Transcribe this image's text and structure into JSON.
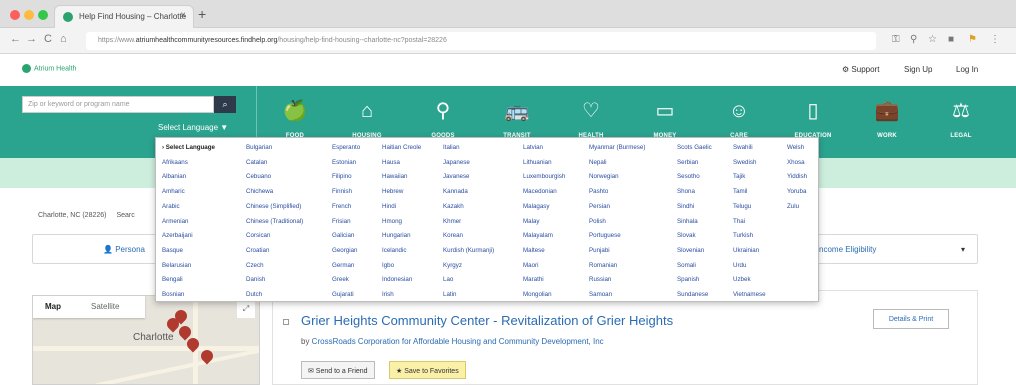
{
  "browser": {
    "tab_title": "Help Find Housing – Charlotte",
    "tab_close": "×",
    "new_tab": "+",
    "back_glyph": "←",
    "forward_glyph": "→",
    "reload_glyph": "C",
    "home_glyph": "⌂",
    "url_prefix": "https://www.",
    "url_bold": "atriumhealthcommunityresources.findhelp.org",
    "url_rest": "/housing/help-find-housing--charlotte-nc?postal=28226"
  },
  "site": {
    "logo_text": "Atrium Health",
    "support_label": "Support",
    "signup_label": "Sign Up",
    "login_label": "Log In"
  },
  "search": {
    "placeholder": "Zip or keyword or program name",
    "button_glyph": "🔍",
    "select_language_label": "Select Language ▼"
  },
  "categories": [
    {
      "label": "FOOD",
      "icon": "🍏"
    },
    {
      "label": "HOUSING",
      "icon": "⌂"
    },
    {
      "label": "GOODS",
      "icon": "⚲"
    },
    {
      "label": "TRANSIT",
      "icon": "🚌"
    },
    {
      "label": "HEALTH",
      "icon": "♡"
    },
    {
      "label": "MONEY",
      "icon": "▭"
    },
    {
      "label": "CARE",
      "icon": "☺"
    },
    {
      "label": "EDUCATION",
      "icon": "▯"
    },
    {
      "label": "WORK",
      "icon": "💼"
    },
    {
      "label": "LEGAL",
      "icon": "⚖"
    }
  ],
  "languages": {
    "selected": "› Select Language",
    "columns": [
      [
        "› Select Language",
        "Afrikaans",
        "Albanian",
        "Amharic",
        "Arabic",
        "Armenian",
        "Azerbaijani",
        "Basque",
        "Belarusian",
        "Bengali",
        "Bosnian"
      ],
      [
        "Bulgarian",
        "Catalan",
        "Cebuano",
        "Chichewa",
        "Chinese (Simplified)",
        "Chinese (Traditional)",
        "Corsican",
        "Croatian",
        "Czech",
        "Danish",
        "Dutch"
      ],
      [
        "Esperanto",
        "Estonian",
        "Filipino",
        "Finnish",
        "French",
        "Frisian",
        "Galician",
        "Georgian",
        "German",
        "Greek",
        "Gujarati"
      ],
      [
        "Haitian Creole",
        "Hausa",
        "Hawaiian",
        "Hebrew",
        "Hindi",
        "Hmong",
        "Hungarian",
        "Icelandic",
        "Igbo",
        "Indonesian",
        "Irish"
      ],
      [
        "Italian",
        "Japanese",
        "Javanese",
        "Kannada",
        "Kazakh",
        "Khmer",
        "Korean",
        "Kurdish (Kurmanji)",
        "Kyrgyz",
        "Lao",
        "Latin"
      ],
      [
        "Latvian",
        "Lithuanian",
        "Luxembourgish",
        "Macedonian",
        "Malagasy",
        "Malay",
        "Malayalam",
        "Maltese",
        "Maori",
        "Marathi",
        "Mongolian"
      ],
      [
        "Myanmar (Burmese)",
        "Nepali",
        "Norwegian",
        "Pashto",
        "Persian",
        "Polish",
        "Portuguese",
        "Punjabi",
        "Romanian",
        "Russian",
        "Samoan"
      ],
      [
        "Scots Gaelic",
        "Serbian",
        "Sesotho",
        "Shona",
        "Sindhi",
        "Sinhala",
        "Slovak",
        "Slovenian",
        "Somali",
        "Spanish",
        "Sundanese"
      ],
      [
        "Swahili",
        "Swedish",
        "Tajik",
        "Tamil",
        "Telugu",
        "Thai",
        "Turkish",
        "Ukrainian",
        "Urdu",
        "Uzbek",
        "Vietnamese"
      ],
      [
        "Welsh",
        "Xhosa",
        "Yiddish",
        "Yoruba",
        "Zulu"
      ]
    ]
  },
  "page": {
    "location": "Charlotte, NC (28226)",
    "location_suffix": "Searc",
    "filter_personal": "Persona",
    "filter_income": "ncome Eligibility",
    "filter_chevron": "▾"
  },
  "map": {
    "tab_map": "Map",
    "tab_satellite": "Satellite",
    "city_label": "Charlotte",
    "fullscreen_glyph": "⤢"
  },
  "result": {
    "title": "Grier Heights Community Center - Revitalization of Grier Heights",
    "by_prefix": "by ",
    "provider": "CrossRoads Corporation for Affordable Housing and Community Development, Inc",
    "send_label": "✉ Send to a Friend",
    "save_label": "★ Save to Favorites",
    "details_label": "Details & Print"
  },
  "colors": {
    "teal": "#2aa38f",
    "banner": "#cdeedd",
    "link": "#2a6cb3"
  }
}
